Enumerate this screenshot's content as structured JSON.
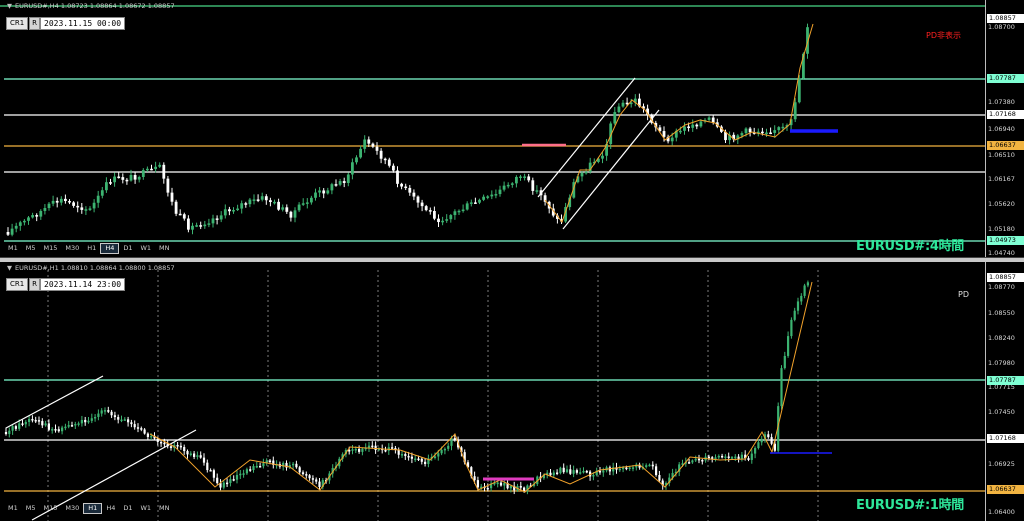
{
  "top_chart": {
    "info": "EURUSD#,H4  1.08723 1.08864 1.08672 1.08857",
    "cr_label": "CR1",
    "r_label": "R",
    "datetime": "2023.11.15 00:00",
    "pd_label": "PD非表示",
    "title": "EURUSD#:4時間",
    "timeframes": [
      "M1",
      "M5",
      "M15",
      "M30",
      "H1",
      "H4",
      "D1",
      "W1",
      "MN"
    ],
    "active_timeframe": "H4",
    "price_labels": [
      "1.08700",
      "1.07380",
      "1.06940",
      "1.06510",
      "1.06167",
      "1.05620",
      "1.05180",
      "1.04740"
    ],
    "highlight_labels": [
      {
        "value": "1.08857",
        "color": "#ffffff"
      },
      {
        "value": "1.07787",
        "color": "#7fffd4"
      },
      {
        "value": "1.07168",
        "color": "#ffffff"
      },
      {
        "value": "1.06637",
        "color": "#f2b441"
      },
      {
        "value": "1.04973",
        "color": "#7fffd4"
      }
    ]
  },
  "bottom_chart": {
    "info": "EURUSD#,H1  1.08810 1.08864 1.08800 1.08857",
    "cr_label": "CR1",
    "r_label": "R",
    "datetime": "2023.11.14 23:00",
    "pd_label": "PD",
    "title": "EURUSD#:1時間",
    "timeframes": [
      "M1",
      "M5",
      "M15",
      "M30",
      "H1",
      "H4",
      "D1",
      "W1",
      "MN"
    ],
    "active_timeframe": "H1",
    "price_labels": [
      "1.08770",
      "1.08550",
      "1.08240",
      "1.07980",
      "1.07715",
      "1.07450",
      "1.06925",
      "1.06400"
    ],
    "highlight_labels": [
      {
        "value": "1.08857",
        "color": "#ffffff"
      },
      {
        "value": "1.07787",
        "color": "#7fffd4"
      },
      {
        "value": "1.07168",
        "color": "#ffffff"
      },
      {
        "value": "1.06637",
        "color": "#f2b441"
      }
    ]
  },
  "colors": {
    "background": "#000000",
    "bull_candle": "#3cb371",
    "bear_candle": "#ffffff",
    "resistance_line": "#7fffd4",
    "support_line": "#ffffff",
    "key_level": "#f2b441",
    "zigzag": "#f2a22b",
    "title": "#2ee69a",
    "pd_hidden": "#ff2020",
    "blue_marker": "#1a1aff",
    "pink_marker": "#ff6f8a",
    "magenta_marker": "#e03cbf"
  }
}
